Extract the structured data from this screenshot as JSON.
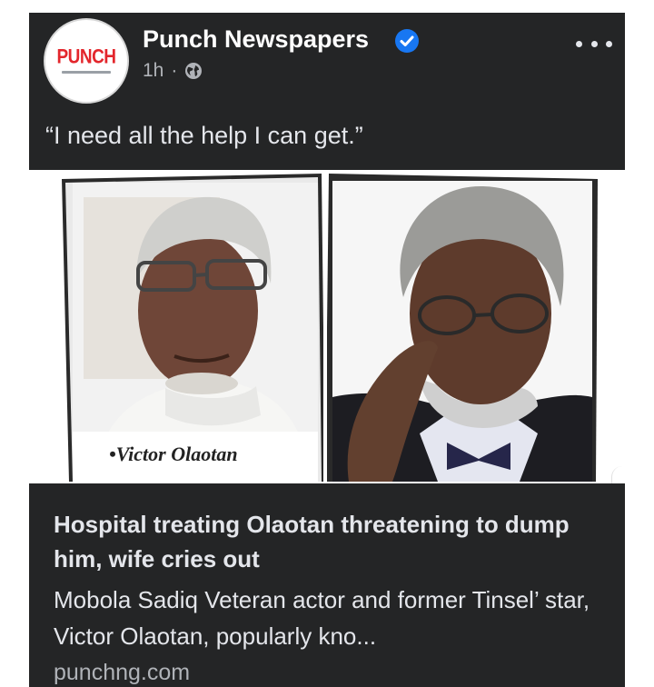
{
  "post": {
    "page_name": "Punch Newspapers",
    "logo_text": "PUNCH",
    "timestamp": "1h",
    "separator": "·",
    "privacy_icon": "globe-icon",
    "verified_icon": "verified-badge-icon",
    "more_icon": "more-options-icon",
    "text": "“I need all the help I can get.”"
  },
  "photo": {
    "caption": "•Victor Olaotan"
  },
  "link_preview": {
    "headline": "Hospital treating Olaotan threatening to dump him, wife cries out",
    "summary": "Mobola Sadiq Veteran actor and former Tinsel’ star, Victor Olaotan, popularly kno...",
    "domain": "punchng.com"
  },
  "colors": {
    "card_bg": "#242526",
    "text_primary": "#e4e6eb",
    "text_secondary": "#b0b3b8",
    "verified_blue": "#1877f2",
    "brand_red": "#e3262c"
  }
}
